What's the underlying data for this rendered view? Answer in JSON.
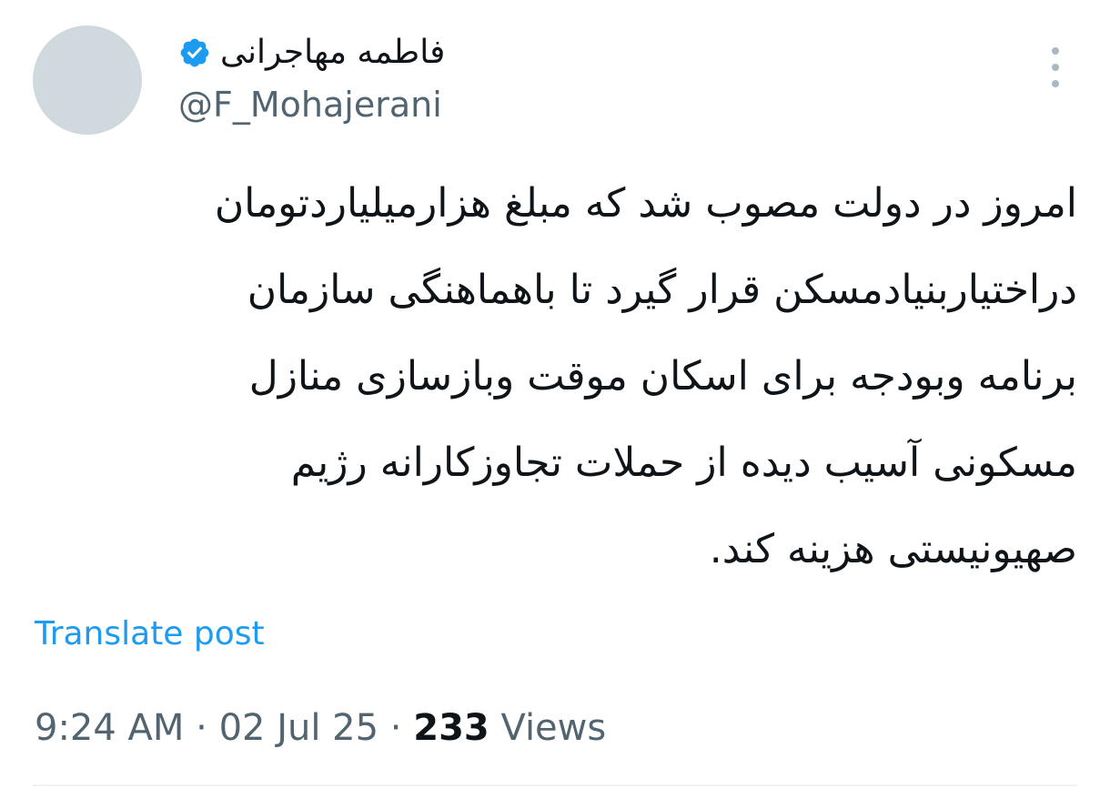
{
  "author": {
    "display_name": "فاطمه مهاجرانی",
    "handle": "@F_Mohajerani",
    "verified": true
  },
  "tweet": {
    "lines": [
      "امروز در دولت مصوب شد که مبلغ هزارمیلیاردتومان",
      "دراختیاربنیادمسکن قرار گیرد تا باهماهنگی سازمان",
      "برنامه وبودجه برای اسکان موقت وبازسازی منازل",
      "مسکونی آسیب دیده از حملات تجاوزکارانه رژیم",
      "صهیونیستی هزینه کند."
    ]
  },
  "translate_label": "Translate post",
  "meta": {
    "time": "9:24 AM",
    "separator": "·",
    "date": "02 Jul 25",
    "views_count": "233",
    "views_label": "Views"
  },
  "icons": {
    "verified": "verified-badge-icon",
    "more": "more-options-icon"
  },
  "colors": {
    "accent": "#1d9bf0",
    "secondary_text": "#536471",
    "primary_text": "#0f1419",
    "avatar_placeholder": "#cfd9de"
  }
}
